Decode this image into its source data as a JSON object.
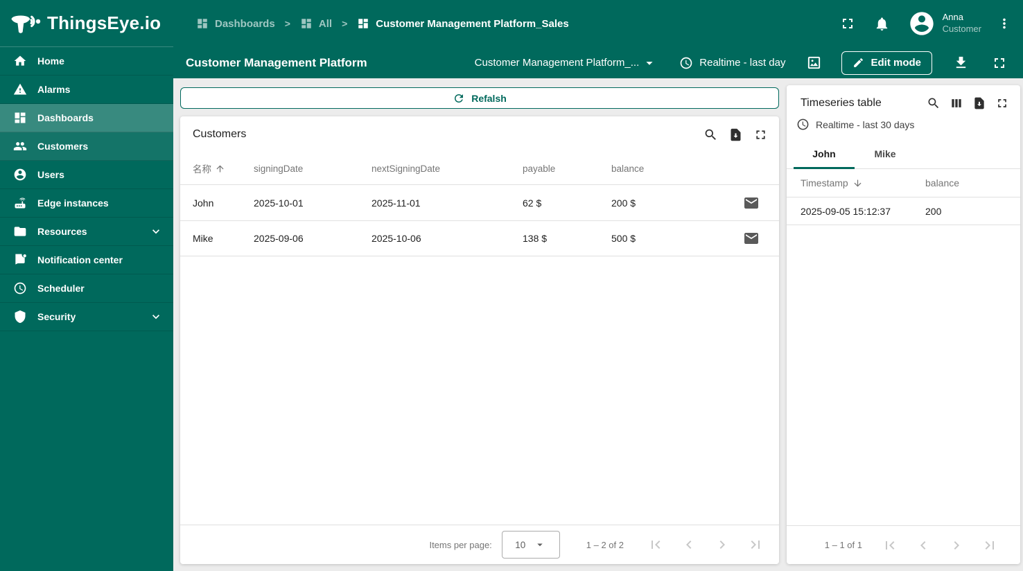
{
  "brand": {
    "name": "ThingsEye.io"
  },
  "topbar": {
    "breadcrumbs": [
      "Dashboards",
      "All",
      "Customer Management Platform_Sales"
    ],
    "separator": ">",
    "user_name": "Anna",
    "user_role": "Customer"
  },
  "sidebar": {
    "items": [
      {
        "label": "Home"
      },
      {
        "label": "Alarms"
      },
      {
        "label": "Dashboards"
      },
      {
        "label": "Customers"
      },
      {
        "label": "Users"
      },
      {
        "label": "Edge instances"
      },
      {
        "label": "Resources"
      },
      {
        "label": "Notification center"
      },
      {
        "label": "Scheduler"
      },
      {
        "label": "Security"
      }
    ]
  },
  "dashboard_header": {
    "title": "Customer Management Platform",
    "state_selector": "Customer Management Platform_...",
    "timewindow": "Realtime - last day",
    "edit_button": "Edit mode"
  },
  "refresh_button": "Refalsh",
  "customers_widget": {
    "title": "Customers",
    "columns": [
      "名称",
      "signingDate",
      "nextSigningDate",
      "payable",
      "balance"
    ],
    "sort_column": "名称",
    "sort_direction": "asc",
    "rows": [
      {
        "name": "John",
        "signingDate": "2025-10-01",
        "nextSigningDate": "2025-11-01",
        "payable": "62 $",
        "balance": "200 $"
      },
      {
        "name": "Mike",
        "signingDate": "2025-09-06",
        "nextSigningDate": "2025-10-06",
        "payable": "138 $",
        "balance": "500 $"
      }
    ],
    "pagination": {
      "items_per_page_label": "Items per page:",
      "page_size": "10",
      "range_label": "1 – 2 of 2"
    }
  },
  "timeseries_widget": {
    "title": "Timeseries table",
    "timewindow": "Realtime - last 30 days",
    "tabs": [
      "John",
      "Mike"
    ],
    "active_tab": "John",
    "columns": [
      "Timestamp",
      "balance"
    ],
    "sort_column": "Timestamp",
    "sort_direction": "desc",
    "rows": [
      {
        "timestamp": "2025-09-05 15:12:37",
        "balance": "200"
      }
    ],
    "pagination": {
      "range_label": "1 – 1 of 1"
    }
  },
  "colors": {
    "primary": "#00695c",
    "page_bg": "#ececec",
    "active_sidebar_overlay": "rgba(255,255,255,0.22)"
  }
}
